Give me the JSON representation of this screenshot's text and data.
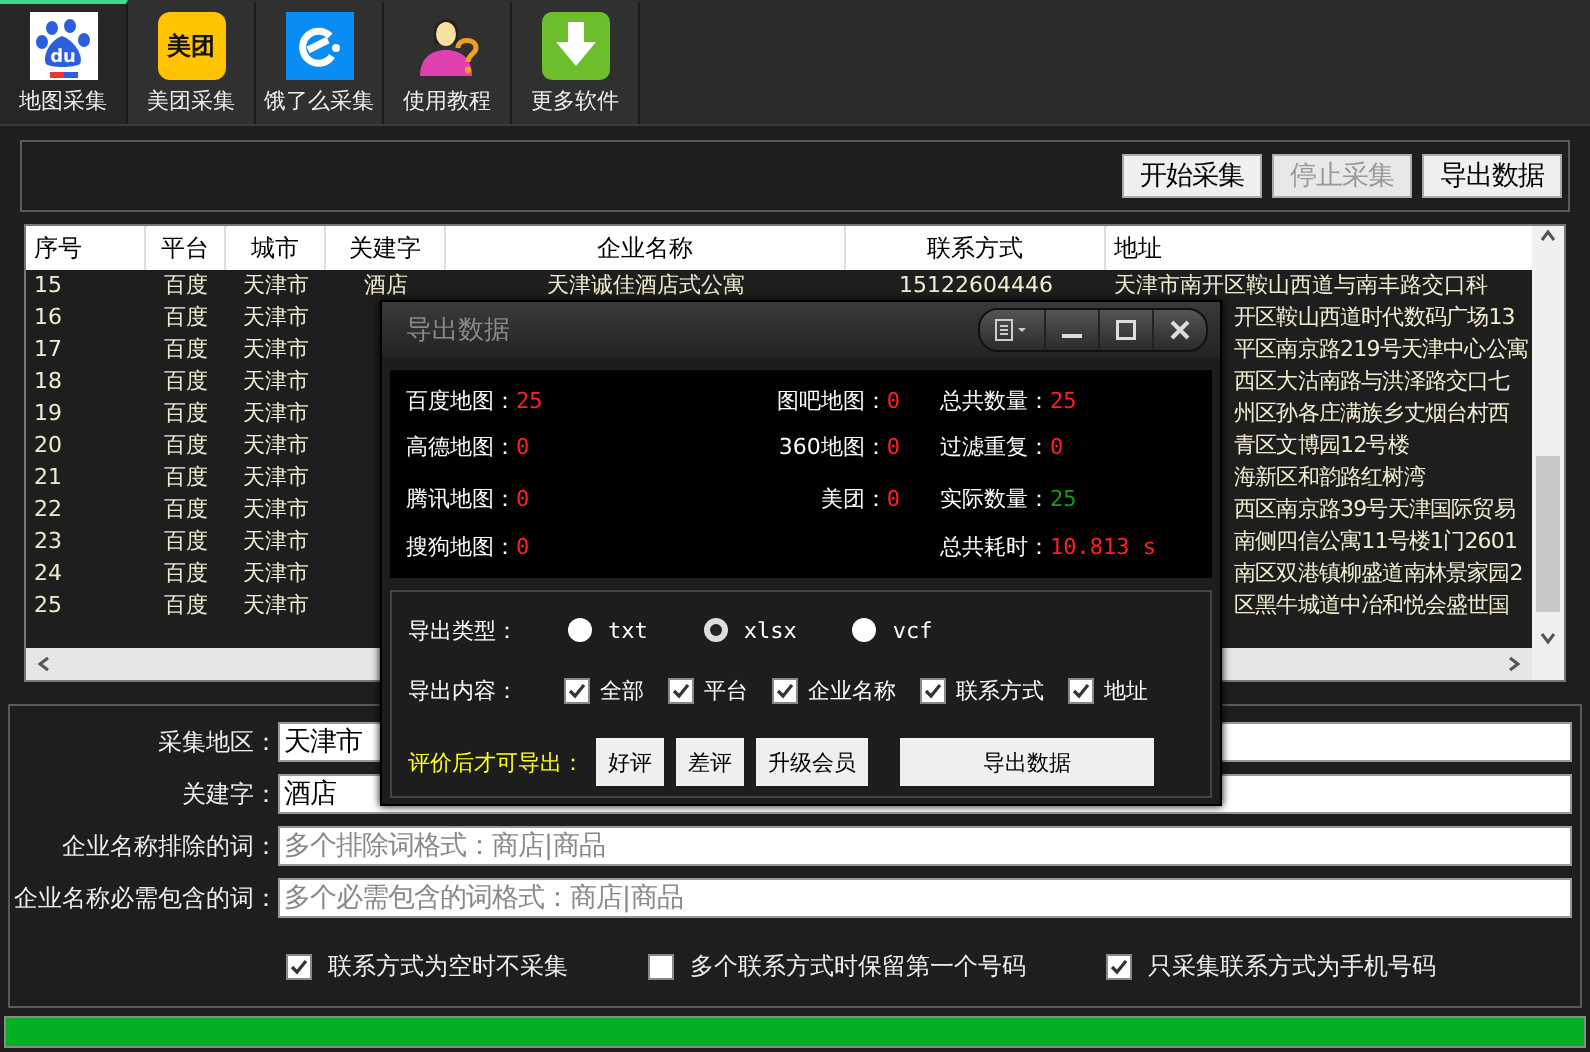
{
  "tabs": [
    {
      "kind": "baidu",
      "logo_text": "du",
      "label": "地图采集",
      "selected": true
    },
    {
      "kind": "meituan",
      "logo_text": "美团",
      "label": "美团采集",
      "selected": false
    },
    {
      "kind": "eleme",
      "label": "饿了么采集",
      "selected": false
    },
    {
      "kind": "tutorial",
      "label": "使用教程",
      "selected": false
    },
    {
      "kind": "more",
      "label": "更多软件",
      "selected": false
    }
  ],
  "toolbar": [
    {
      "label": "开始采集",
      "disabled": false
    },
    {
      "label": "停止采集",
      "disabled": true
    },
    {
      "label": "导出数据",
      "disabled": false
    }
  ],
  "table": {
    "columns": [
      "序号",
      "平台",
      "城市",
      "关建字",
      "企业名称",
      "联系方式",
      "地址"
    ],
    "rows": [
      {
        "no": "15",
        "platform": "百度",
        "city": "天津市",
        "keyword": "酒店",
        "company": "天津诚佳酒店式公寓",
        "phone": "15122604446",
        "address": "天津市南开区鞍山西道与南丰路交口科"
      },
      {
        "no": "16",
        "platform": "百度",
        "city": "天津市",
        "address": "开区鞍山西道时代数码广场13"
      },
      {
        "no": "17",
        "platform": "百度",
        "city": "天津市",
        "address": "平区南京路219号天津中心公寓"
      },
      {
        "no": "18",
        "platform": "百度",
        "city": "天津市",
        "address": "西区大沽南路与洪泽路交口七"
      },
      {
        "no": "19",
        "platform": "百度",
        "city": "天津市",
        "address": "州区孙各庄满族乡丈烟台村西"
      },
      {
        "no": "20",
        "platform": "百度",
        "city": "天津市",
        "address": "青区文博园12号楼"
      },
      {
        "no": "21",
        "platform": "百度",
        "city": "天津市",
        "address": "海新区和韵路红树湾"
      },
      {
        "no": "22",
        "platform": "百度",
        "city": "天津市",
        "address": "西区南京路39号天津国际贸易"
      },
      {
        "no": "23",
        "platform": "百度",
        "city": "天津市",
        "address": "南侧四信公寓11号楼1门2601"
      },
      {
        "no": "24",
        "platform": "百度",
        "city": "天津市",
        "address": "南区双港镇柳盛道南林景家园2"
      },
      {
        "no": "25",
        "platform": "百度",
        "city": "天津市",
        "address": "区黑牛城道中冶和悦会盛世国"
      }
    ]
  },
  "dialog": {
    "title": "导出数据",
    "stats": [
      [
        {
          "label": "百度地图：",
          "value": "25",
          "color": "#ff2020"
        },
        {
          "label": "高德地图：",
          "value": "0",
          "color": "#ff2020"
        },
        {
          "label": "腾讯地图：",
          "value": "0",
          "color": "#ff2020"
        },
        {
          "label": "搜狗地图：",
          "value": "0",
          "color": "#ff2020"
        }
      ],
      [
        {
          "label": "图吧地图：",
          "value": "0",
          "color": "#ff2020"
        },
        {
          "label": "360地图：",
          "value": "0",
          "color": "#ff2020"
        },
        {
          "label": "美团：",
          "value": "0",
          "color": "#ff2020"
        }
      ],
      [
        {
          "label": "总共数量：",
          "value": "25",
          "color": "#ff2020"
        },
        {
          "label": "过滤重复：",
          "value": "0",
          "color": "#ff2020"
        },
        {
          "label": "实际数量：",
          "value": "25",
          "color": "#1a9a1a"
        },
        {
          "label": "总共耗时：",
          "value": "10.813 s",
          "color": "#ff2020"
        }
      ]
    ],
    "export_type": {
      "label": "导出类型：",
      "options": [
        {
          "label": "txt",
          "selected": false
        },
        {
          "label": "xlsx",
          "selected": true
        },
        {
          "label": "vcf",
          "selected": false
        }
      ]
    },
    "export_content": {
      "label": "导出内容：",
      "options": [
        {
          "label": "全部",
          "checked": true
        },
        {
          "label": "平台",
          "checked": true
        },
        {
          "label": "企业名称",
          "checked": true
        },
        {
          "label": "联系方式",
          "checked": true
        },
        {
          "label": "地址",
          "checked": true
        }
      ]
    },
    "review": {
      "label": "评价后才可导出：",
      "buttons": [
        "好评",
        "差评",
        "升级会员"
      ],
      "export_button": "导出数据"
    }
  },
  "form": {
    "fields": [
      {
        "label": "采集地区：",
        "value": "天津市"
      },
      {
        "label": "关建字：",
        "value": "酒店"
      },
      {
        "label": "企业名称排除的词：",
        "placeholder": "多个排除词格式：商店|商品"
      },
      {
        "label": "企业名称必需包含的词：",
        "placeholder": "多个必需包含的词格式：商店|商品"
      }
    ],
    "options": [
      {
        "label": "联系方式为空时不采集",
        "checked": true
      },
      {
        "label": "多个联系方式时保留第一个号码",
        "checked": false
      },
      {
        "label": "只采集联系方式为手机号码",
        "checked": true
      }
    ]
  },
  "progress": {
    "level": 1
  }
}
